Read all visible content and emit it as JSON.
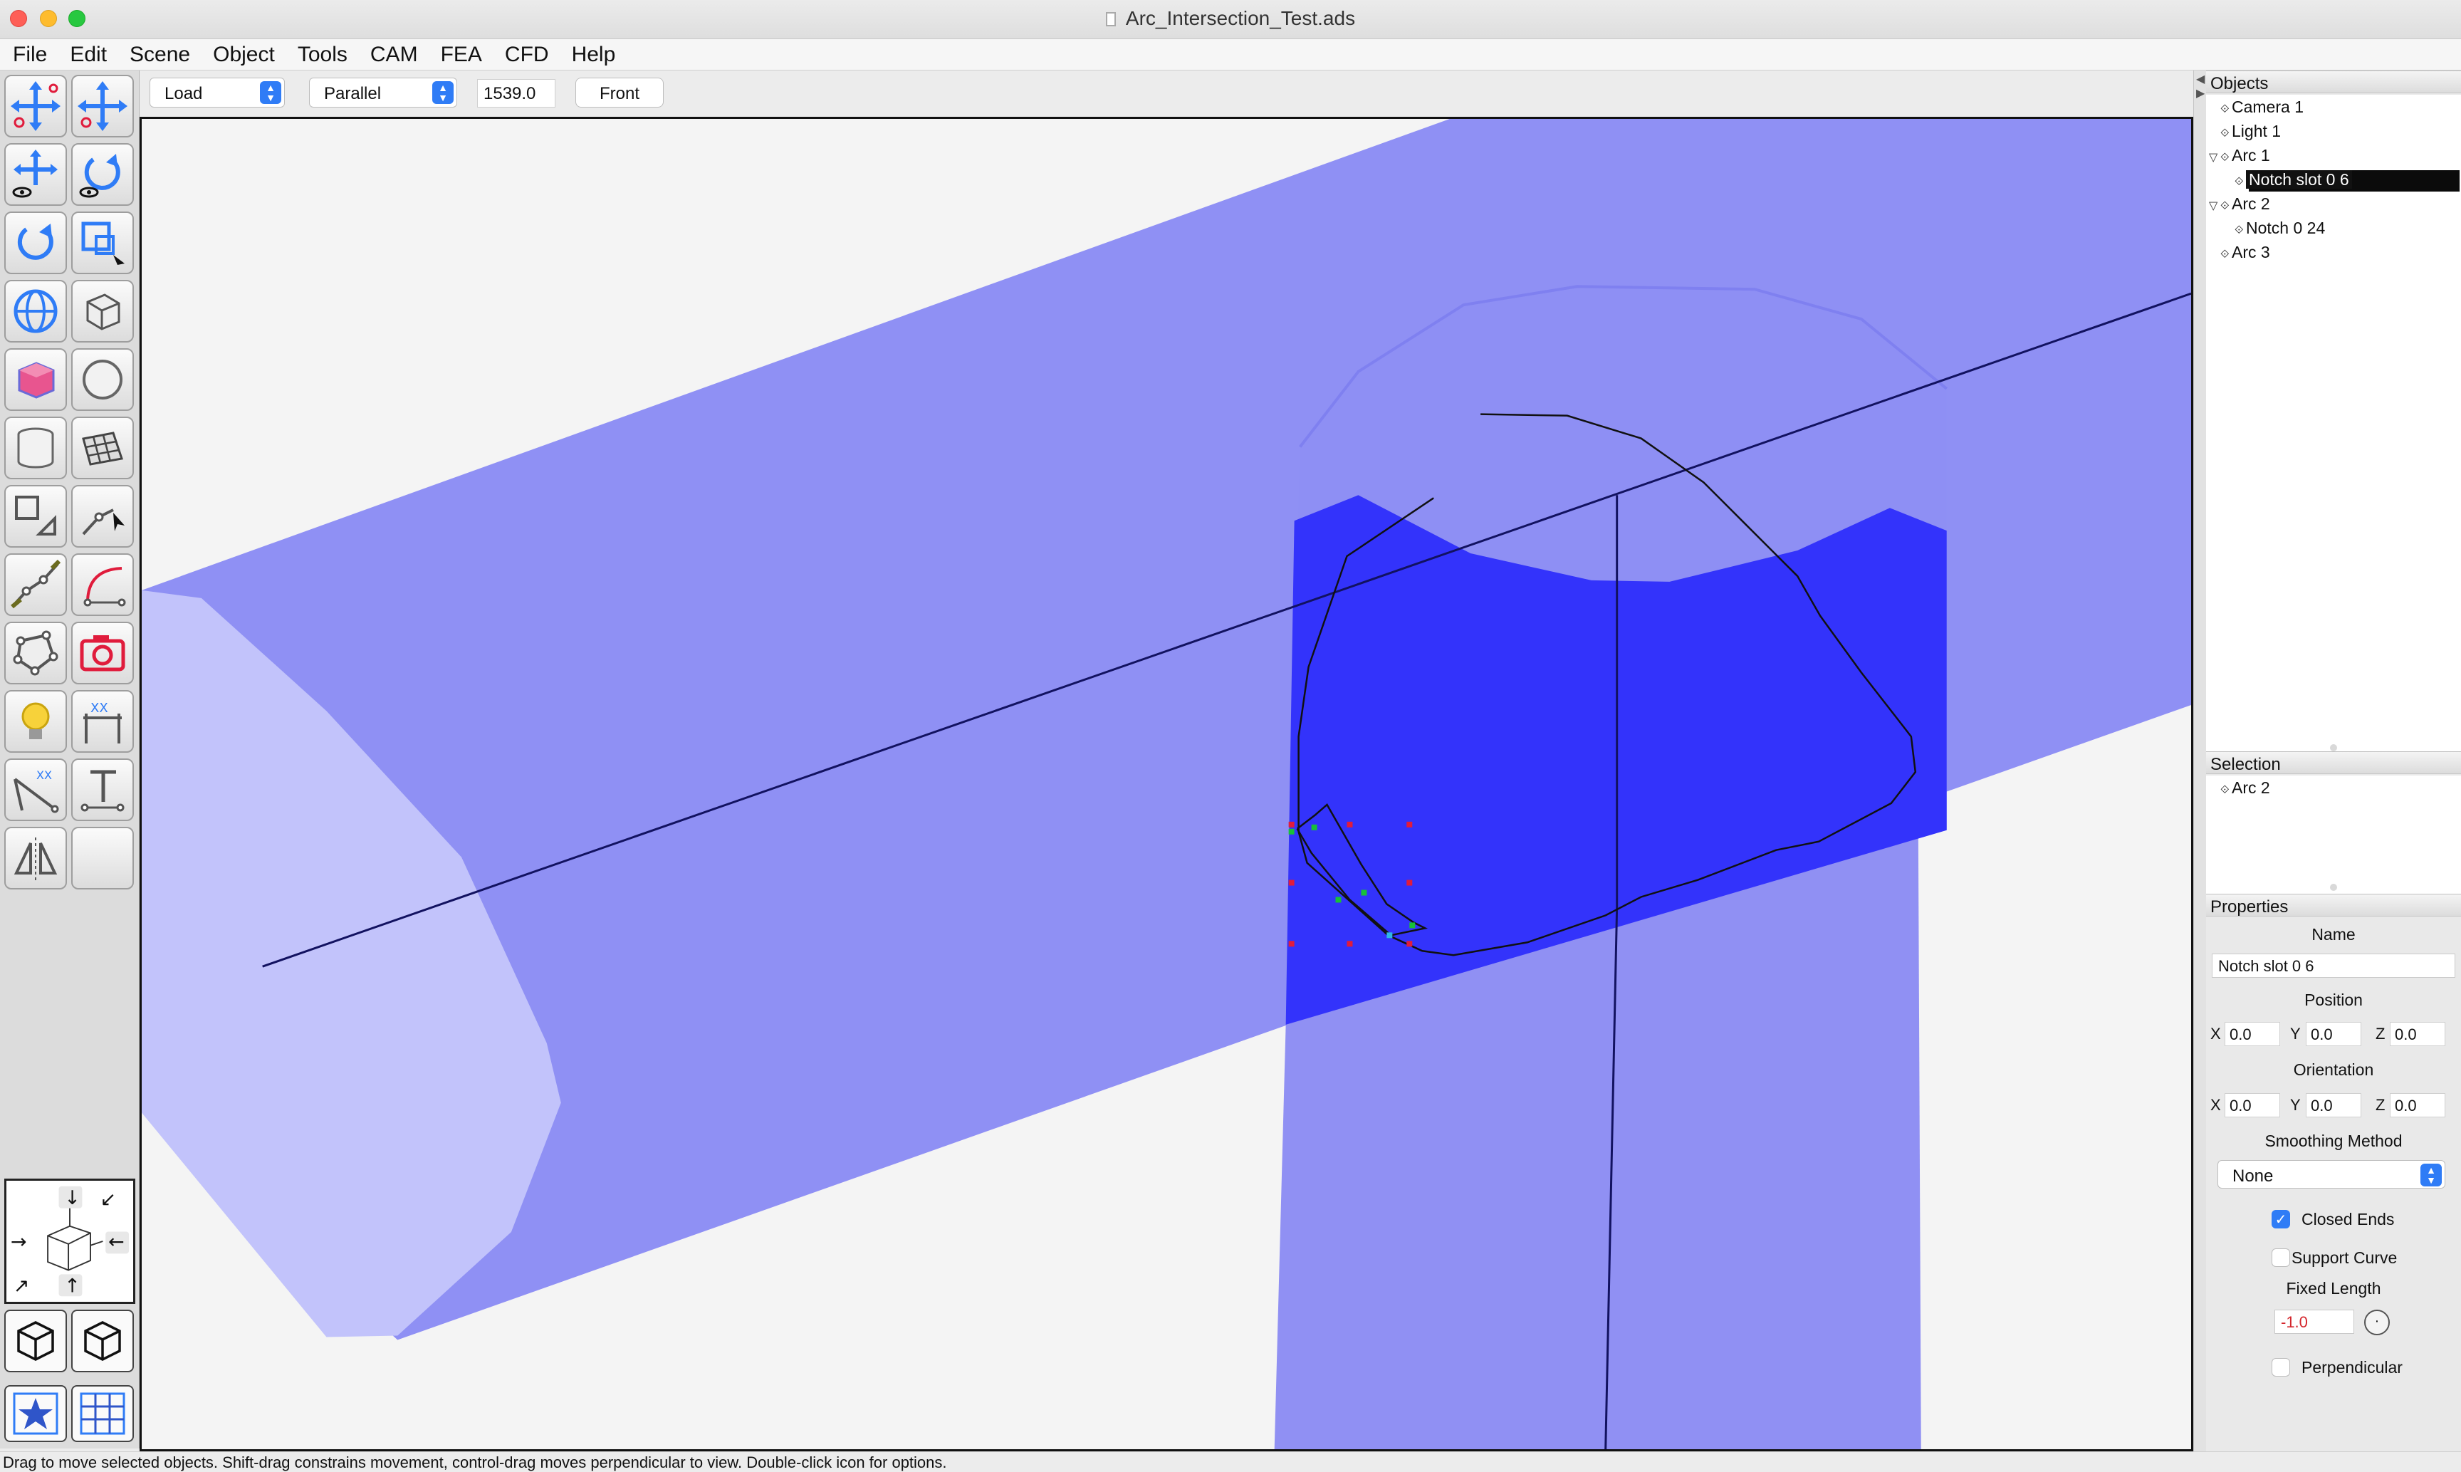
{
  "window": {
    "title": "Arc_Intersection_Test.ads"
  },
  "menu": [
    "File",
    "Edit",
    "Scene",
    "Object",
    "Tools",
    "CAM",
    "FEA",
    "CFD",
    "Help"
  ],
  "toolbar": {
    "mode_select": "Load",
    "projection_select": "Parallel",
    "scale_value": "1539.0",
    "view_button": "Front"
  },
  "tools": [
    "move-points-icon",
    "move-scale-icon",
    "move-view-icon",
    "rotate-view-icon",
    "rotate-icon",
    "scale-select-icon",
    "globe-icon",
    "box-outline-icon",
    "pink-cube-icon",
    "sphere-icon",
    "cylinder-icon",
    "grid-mesh-icon",
    "square-measure-icon",
    "polyline-select-icon",
    "polyline-icon",
    "curve-icon",
    "polygon-edit-icon",
    "camera-icon",
    "light-bulb-icon",
    "dimension-icon",
    "angle-dimension-icon",
    "text-icon",
    "mirror-icon",
    "empty-tool"
  ],
  "objects_panel": {
    "heading": "Objects",
    "items": [
      {
        "label": "Camera 1",
        "indent": 0,
        "expanded": false
      },
      {
        "label": "Light 1",
        "indent": 0,
        "expanded": false
      },
      {
        "label": "Arc 1",
        "indent": 0,
        "expanded": true
      },
      {
        "label": "Notch slot 0 6",
        "indent": 1,
        "expanded": false,
        "selected": true
      },
      {
        "label": "Arc 2",
        "indent": 0,
        "expanded": true
      },
      {
        "label": "Notch 0 24",
        "indent": 1,
        "expanded": false
      },
      {
        "label": "Arc 3",
        "indent": 0,
        "expanded": false
      }
    ]
  },
  "selection_panel": {
    "heading": "Selection",
    "items": [
      "Arc 2"
    ]
  },
  "properties_panel": {
    "heading": "Properties",
    "name_label": "Name",
    "name_value": "Notch slot 0 6",
    "position_label": "Position",
    "position": {
      "x": "0.0",
      "y": "0.0",
      "z": "0.0"
    },
    "orientation_label": "Orientation",
    "orientation": {
      "x": "0.0",
      "y": "0.0",
      "z": "0.0"
    },
    "smoothing_label": "Smoothing Method",
    "smoothing_value": "None",
    "closed_ends_label": "Closed Ends",
    "closed_ends": true,
    "support_curve_label": "Support Curve",
    "support_curve": false,
    "fixed_length_label": "Fixed Length",
    "fixed_length_value": "-1.0",
    "perpendicular_label": "Perpendicular",
    "perpendicular": false,
    "axis_labels": {
      "x": "X",
      "y": "Y",
      "z": "Z"
    }
  },
  "status": "Drag to move selected objects.  Shift-drag constrains movement, control-drag moves perpendicular to view.  Double-click icon for options.",
  "colors": {
    "viewport_bg": "#f4f4f4",
    "pipe_fill": "#8f90f4",
    "pipe_end": "#c2c3fb",
    "post_body": "#9090f3",
    "overlap": "#3333fb",
    "accent": "#2f7cf6",
    "handle_red": "#e01c3c",
    "handle_green": "#18c038"
  }
}
